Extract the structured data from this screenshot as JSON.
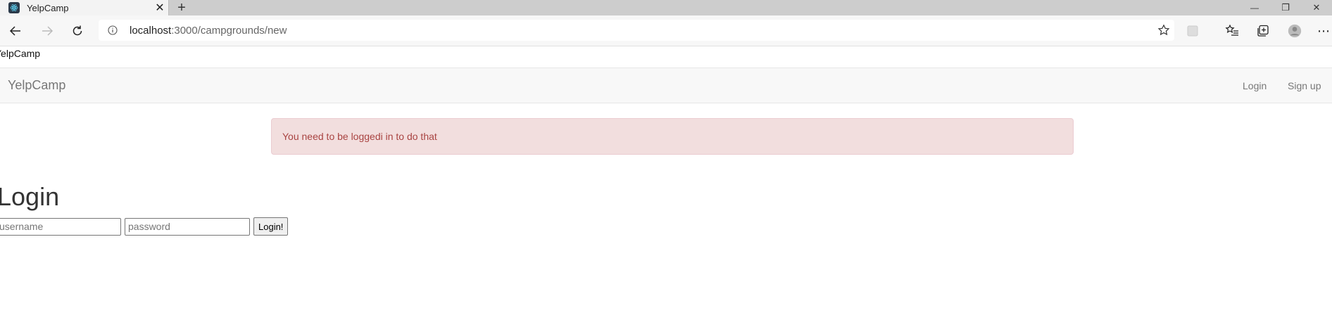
{
  "browser": {
    "tab": {
      "title": "YelpCamp",
      "close_glyph": "✕"
    },
    "newtab_glyph": "+",
    "address": {
      "host": "localhost",
      "path": ":3000/campgrounds/new"
    },
    "window_controls": {
      "minimize": "—",
      "restore": "❐",
      "close": "✕"
    },
    "menu_glyph": "⋯"
  },
  "page": {
    "title_text": "YelpCamp",
    "navbar": {
      "brand": "YelpCamp",
      "links": [
        {
          "label": "Login"
        },
        {
          "label": "Sign up"
        }
      ]
    },
    "alert": {
      "message": "You need to be loggedi in to do that",
      "color": "#a94442",
      "background": "#f2dede"
    },
    "login": {
      "heading": "Login",
      "username_placeholder": "username",
      "password_placeholder": "password",
      "submit_label": "Login!"
    }
  }
}
